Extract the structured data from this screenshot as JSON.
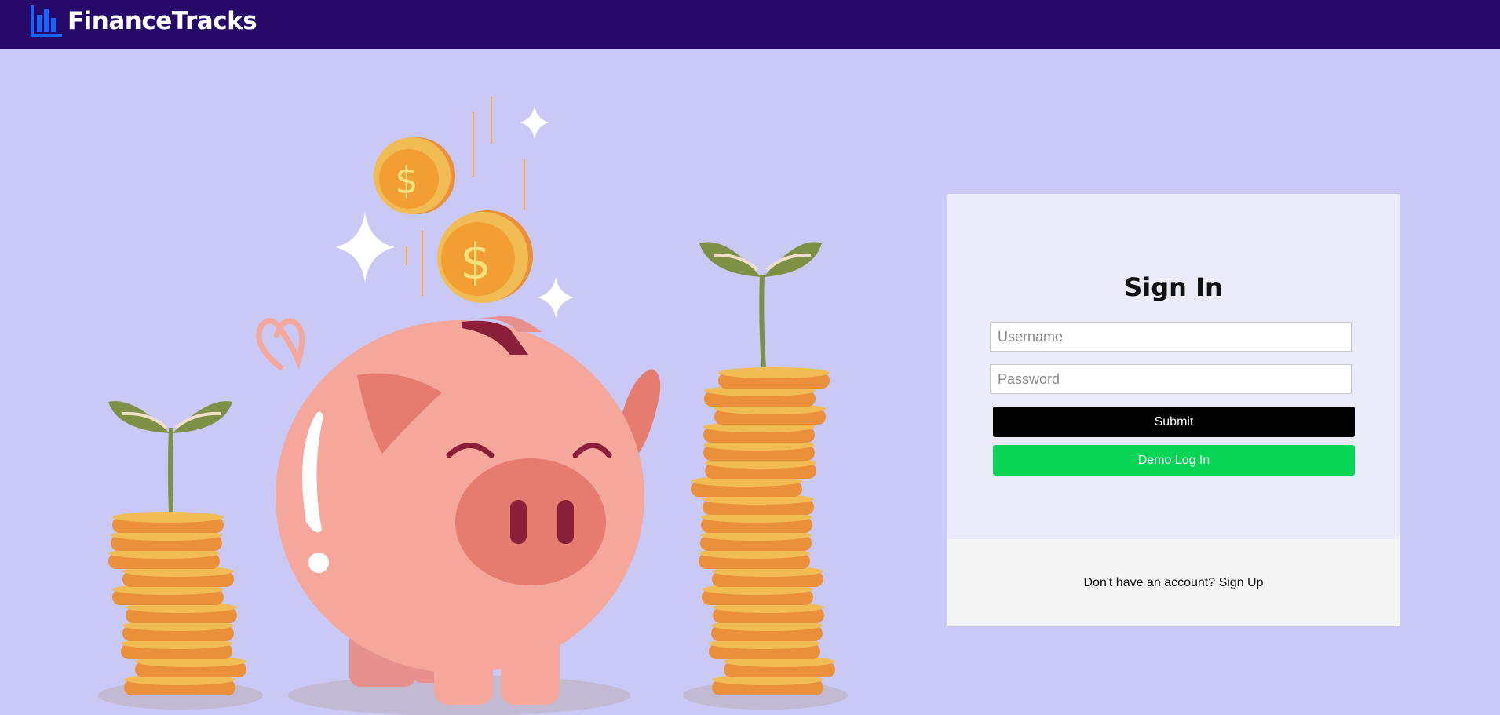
{
  "app": {
    "name": "FinanceTracks",
    "logo_icon": "bar-chart-icon"
  },
  "colors": {
    "header_bg": "#250868",
    "page_bg": "#cac8f5",
    "submit_bg": "#000000",
    "demo_bg": "#08d456"
  },
  "hero": {
    "illustration": "piggy-bank-coins-illustration",
    "coin_symbol": "$"
  },
  "signin": {
    "title": "Sign In",
    "username_placeholder": "Username",
    "username_value": "",
    "password_placeholder": "Password",
    "password_value": "",
    "submit_label": "Submit",
    "demo_label": "Demo Log In",
    "footer_text": "Don't have an account? ",
    "signup_link": "Sign Up"
  }
}
